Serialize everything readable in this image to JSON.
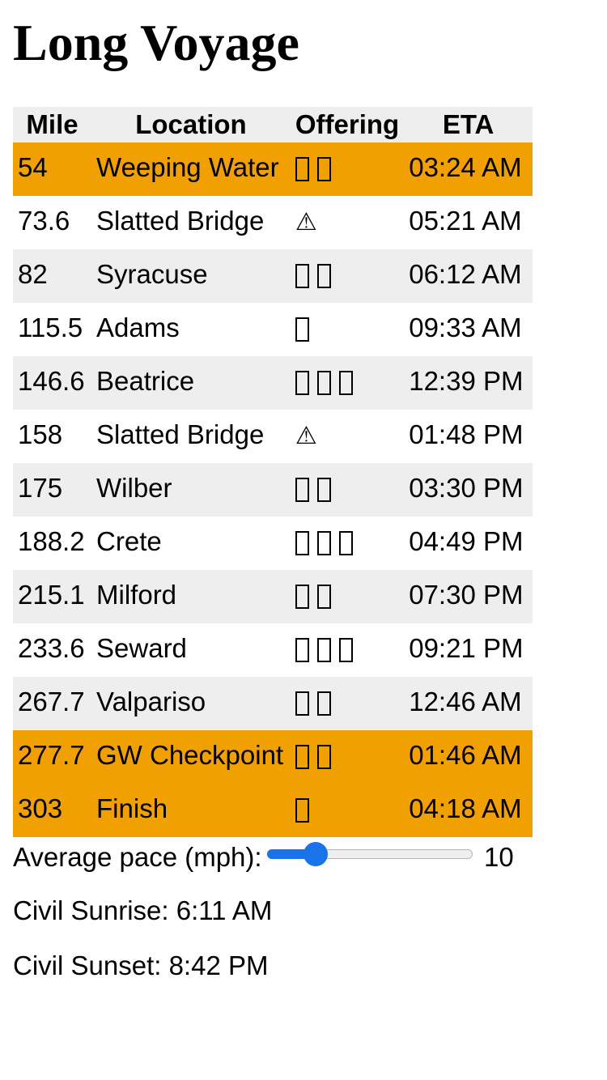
{
  "title": "Long Voyage",
  "table": {
    "headers": {
      "mile": "Mile",
      "location": "Location",
      "offering": "Offering",
      "eta": "ETA"
    },
    "rows": [
      {
        "mile": "54",
        "location": "Weeping Water",
        "offering_icons": [
          "box-glyph",
          "box-glyph"
        ],
        "eta": "03:24 AM",
        "highlight": true
      },
      {
        "mile": "73.6",
        "location": "Slatted Bridge",
        "offering_icons": [
          "warning-icon"
        ],
        "offering_text": "⚠",
        "eta": "05:21 AM",
        "highlight": false
      },
      {
        "mile": "82",
        "location": "Syracuse",
        "offering_icons": [
          "box-glyph",
          "box-glyph"
        ],
        "eta": "06:12 AM",
        "highlight": false
      },
      {
        "mile": "115.5",
        "location": "Adams",
        "offering_icons": [
          "box-glyph"
        ],
        "eta": "09:33 AM",
        "highlight": false
      },
      {
        "mile": "146.6",
        "location": "Beatrice",
        "offering_icons": [
          "box-glyph",
          "box-glyph",
          "box-glyph"
        ],
        "eta": "12:39 PM",
        "highlight": false
      },
      {
        "mile": "158",
        "location": "Slatted Bridge",
        "offering_icons": [
          "warning-icon"
        ],
        "offering_text": "⚠",
        "eta": "01:48 PM",
        "highlight": false
      },
      {
        "mile": "175",
        "location": "Wilber",
        "offering_icons": [
          "box-glyph",
          "box-glyph"
        ],
        "eta": "03:30 PM",
        "highlight": false
      },
      {
        "mile": "188.2",
        "location": "Crete",
        "offering_icons": [
          "box-glyph",
          "box-glyph",
          "box-glyph"
        ],
        "eta": "04:49 PM",
        "highlight": false
      },
      {
        "mile": "215.1",
        "location": "Milford",
        "offering_icons": [
          "box-glyph",
          "box-glyph"
        ],
        "eta": "07:30 PM",
        "highlight": false
      },
      {
        "mile": "233.6",
        "location": "Seward",
        "offering_icons": [
          "box-glyph",
          "box-glyph",
          "box-glyph"
        ],
        "eta": "09:21 PM",
        "highlight": false
      },
      {
        "mile": "267.7",
        "location": "Valpariso",
        "offering_icons": [
          "box-glyph",
          "box-glyph"
        ],
        "eta": "12:46 AM",
        "highlight": false
      },
      {
        "mile": "277.7",
        "location": "GW Checkpoint",
        "offering_icons": [
          "box-glyph",
          "box-glyph"
        ],
        "eta": "01:46 AM",
        "highlight": true
      },
      {
        "mile": "303",
        "location": "Finish",
        "offering_icons": [
          "box-glyph"
        ],
        "eta": "04:18 AM",
        "highlight": true
      }
    ]
  },
  "pace": {
    "label": "Average pace (mph):",
    "value": "10",
    "slider_fraction": 0.2
  },
  "sun": {
    "sunrise": "Civil Sunrise: 6:11 AM",
    "sunset": "Civil Sunset: 8:42 PM"
  },
  "colors": {
    "highlight": "#f0a000",
    "alt_row": "#eeeeee",
    "slider_accent": "#1a73e8"
  }
}
